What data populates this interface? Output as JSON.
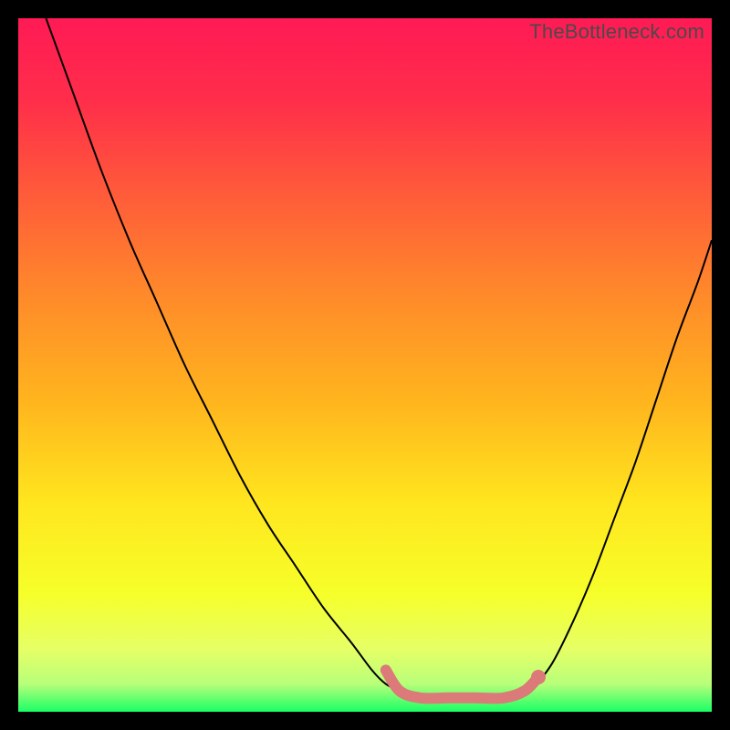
{
  "watermark": "TheBottleneck.com",
  "colors": {
    "frame": "#000000",
    "curve": "#000000",
    "marker": "#db7a78",
    "gradient_stops": [
      {
        "offset": 0.0,
        "color": "#ff1a55"
      },
      {
        "offset": 0.12,
        "color": "#ff2e4a"
      },
      {
        "offset": 0.25,
        "color": "#ff5a3a"
      },
      {
        "offset": 0.4,
        "color": "#ff8a2a"
      },
      {
        "offset": 0.55,
        "color": "#ffb41e"
      },
      {
        "offset": 0.7,
        "color": "#ffe61e"
      },
      {
        "offset": 0.83,
        "color": "#f6ff2a"
      },
      {
        "offset": 0.91,
        "color": "#e6ff66"
      },
      {
        "offset": 0.96,
        "color": "#b8ff7a"
      },
      {
        "offset": 1.0,
        "color": "#1aff66"
      }
    ]
  },
  "chart_data": {
    "type": "line",
    "title": "",
    "xlabel": "",
    "ylabel": "",
    "xlim": [
      0,
      100
    ],
    "ylim": [
      0,
      100
    ],
    "series": [
      {
        "name": "left_branch",
        "x": [
          4,
          8,
          12,
          16,
          20,
          24,
          28,
          32,
          36,
          40,
          44,
          48,
          51,
          53,
          55
        ],
        "y": [
          100,
          89,
          78,
          68,
          59,
          50,
          42,
          34,
          27,
          21,
          15,
          10,
          6,
          4,
          3
        ]
      },
      {
        "name": "right_branch",
        "x": [
          74,
          77,
          80,
          83,
          86,
          89,
          92,
          95,
          98,
          100
        ],
        "y": [
          3,
          7,
          13,
          20,
          28,
          36,
          45,
          54,
          62,
          68
        ]
      },
      {
        "name": "floor_marker",
        "x": [
          53,
          55,
          58,
          62,
          66,
          70,
          73,
          75
        ],
        "y": [
          6,
          3,
          2,
          2,
          2,
          2,
          3,
          5
        ]
      }
    ],
    "marker_dot": {
      "x": 75,
      "y": 5
    },
    "legend": []
  }
}
